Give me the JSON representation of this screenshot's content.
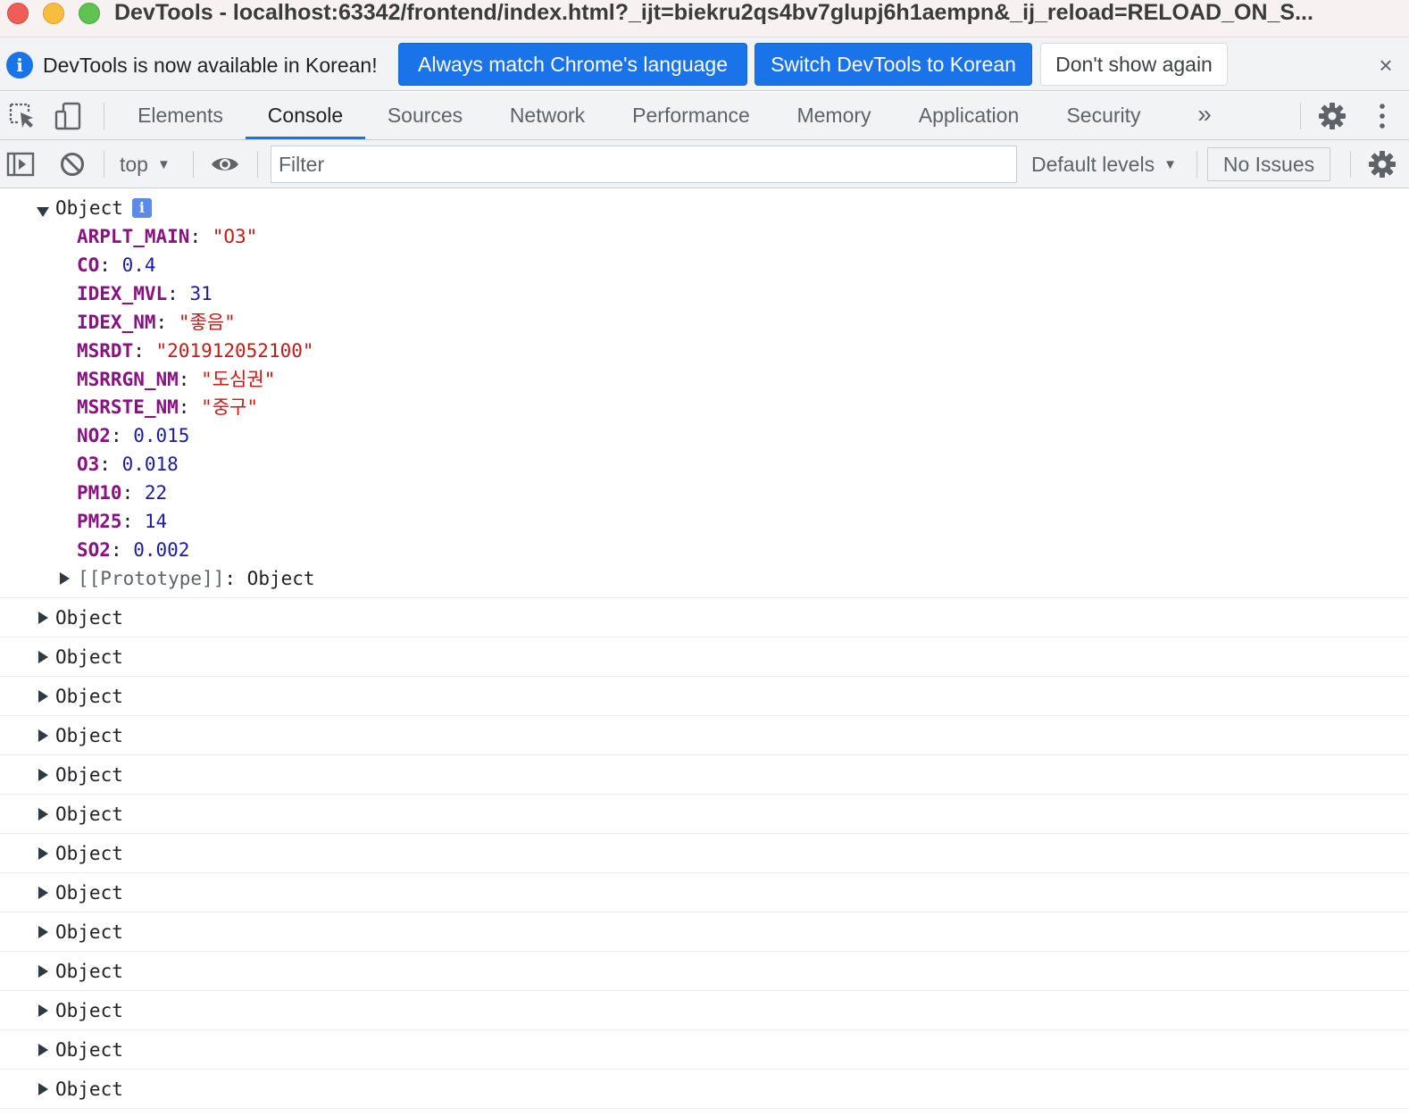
{
  "window": {
    "title": "DevTools - localhost:63342/frontend/index.html?_ijt=biekru2qs4bv7glupj6h1aempn&_ij_reload=RELOAD_ON_S..."
  },
  "infobar": {
    "message": "DevTools is now available in Korean!",
    "btn_match": "Always match Chrome's language",
    "btn_switch": "Switch DevTools to Korean",
    "btn_dismiss": "Don't show again",
    "close": "×"
  },
  "tabs": [
    "Elements",
    "Console",
    "Sources",
    "Network",
    "Performance",
    "Memory",
    "Application",
    "Security"
  ],
  "active_tab": "Console",
  "more_tabs": "»",
  "console_toolbar": {
    "context": "top",
    "filter_placeholder": "Filter",
    "levels": "Default levels",
    "issues": "No Issues"
  },
  "console": {
    "expanded_object": {
      "label": "Object",
      "info_badge": "i",
      "properties": [
        {
          "key": "ARPLT_MAIN",
          "value": "\"O3\"",
          "type": "string"
        },
        {
          "key": "CO",
          "value": "0.4",
          "type": "number"
        },
        {
          "key": "IDEX_MVL",
          "value": "31",
          "type": "number"
        },
        {
          "key": "IDEX_NM",
          "value": "\"좋음\"",
          "type": "string"
        },
        {
          "key": "MSRDT",
          "value": "\"201912052100\"",
          "type": "string"
        },
        {
          "key": "MSRRGN_NM",
          "value": "\"도심권\"",
          "type": "string"
        },
        {
          "key": "MSRSTE_NM",
          "value": "\"중구\"",
          "type": "string"
        },
        {
          "key": "NO2",
          "value": "0.015",
          "type": "number"
        },
        {
          "key": "O3",
          "value": "0.018",
          "type": "number"
        },
        {
          "key": "PM10",
          "value": "22",
          "type": "number"
        },
        {
          "key": "PM25",
          "value": "14",
          "type": "number"
        },
        {
          "key": "SO2",
          "value": "0.002",
          "type": "number"
        }
      ],
      "prototype_key": "[[Prototype]]",
      "prototype_value": "Object"
    },
    "collapsed_objects": [
      "Object",
      "Object",
      "Object",
      "Object",
      "Object",
      "Object",
      "Object",
      "Object",
      "Object",
      "Object",
      "Object",
      "Object",
      "Object"
    ]
  },
  "colors": {
    "accent": "#1a73e8",
    "property_key": "#881280",
    "string_value": "#c41a16",
    "number_value": "#1a1aa6"
  },
  "icons": [
    "inspect-element-icon",
    "device-toolbar-icon",
    "settings-gear-icon",
    "more-options-icon",
    "show-sidebar-icon",
    "clear-console-icon",
    "live-expression-eye-icon",
    "console-settings-gear-icon",
    "info-icon"
  ]
}
